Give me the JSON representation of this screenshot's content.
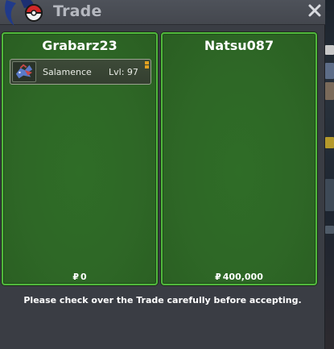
{
  "window": {
    "title": "Trade",
    "close_icon": "close-icon",
    "logo_icon": "pokeball-logo-icon"
  },
  "trade": {
    "left": {
      "player_name": "Grabarz23",
      "currency_symbol": "₽",
      "money": "0",
      "pokemon": [
        {
          "name": "Salamence",
          "level_label": "Lvl: 97",
          "icon": "salamence-sprite-icon"
        }
      ]
    },
    "right": {
      "player_name": "Natsu087",
      "currency_symbol": "₽",
      "money": "400,000",
      "pokemon": []
    }
  },
  "notice": "Please check over the Trade carefully before accepting.",
  "colors": {
    "panel_border": "#50b83c",
    "panel_fill": "#2e6726",
    "window_bg": "#3a3d44",
    "title_text": "#b5b8bf"
  }
}
